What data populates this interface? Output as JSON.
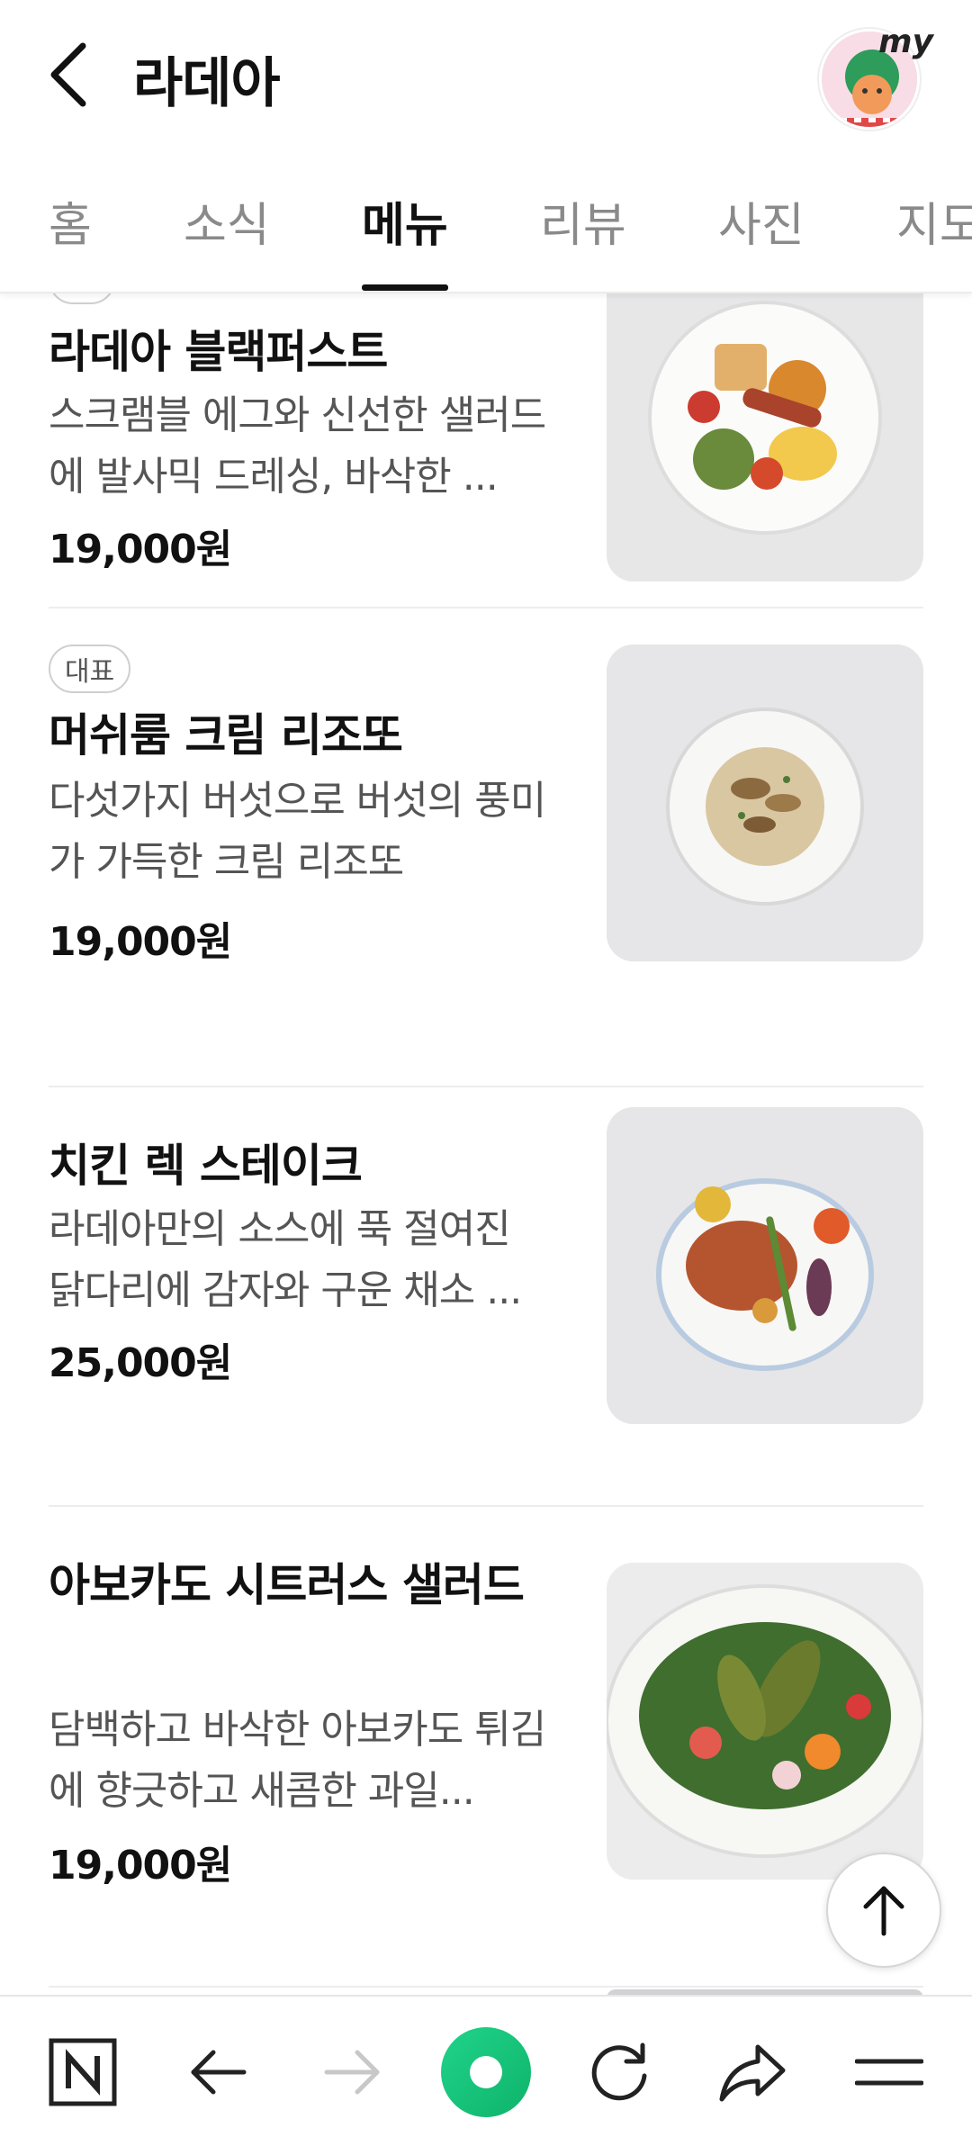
{
  "header": {
    "title": "라데아",
    "my_label": "my"
  },
  "tabs": [
    {
      "label": "홈",
      "active": false
    },
    {
      "label": "소식",
      "active": false
    },
    {
      "label": "메뉴",
      "active": true
    },
    {
      "label": "리뷰",
      "active": false
    },
    {
      "label": "사진",
      "active": false
    },
    {
      "label": "지도",
      "active": false
    }
  ],
  "menu": {
    "items": [
      {
        "badge": "",
        "name": "라데아 블랙퍼스트",
        "desc": "스크램블 에그와 신선한 샐러드에 발사믹 드레싱, 바삭한 ...",
        "price": "19,000원",
        "image_icon": "breakfast-plate"
      },
      {
        "badge": "대표",
        "name": "머쉬룸 크림 리조또",
        "desc": "다섯가지 버섯으로 버섯의 풍미가 가득한 크림 리조또",
        "price": "19,000원",
        "image_icon": "risotto-plate"
      },
      {
        "badge": "",
        "name": "치킨 렉 스테이크",
        "desc": "라데아만의 소스에 푹 절여진 닭다리에 감자와 구운 채소 ...",
        "price": "25,000원",
        "image_icon": "chicken-plate"
      },
      {
        "badge": "",
        "name": "아보카도 시트러스 샐러드",
        "desc": "담백하고 바삭한 아보카도 튀김에 향긋하고 새콤한 과일...",
        "price": "19,000원",
        "image_icon": "salad-plate"
      }
    ]
  },
  "bottom_nav": {
    "items": [
      "naver-home-icon",
      "back-arrow-icon",
      "forward-arrow-icon",
      "green-dot-icon",
      "refresh-icon",
      "share-icon",
      "menu-icon"
    ]
  },
  "colors": {
    "accent_green": "#19c37d",
    "text_primary": "#111111",
    "text_secondary": "#555555",
    "tab_inactive": "#8a8a8a"
  }
}
